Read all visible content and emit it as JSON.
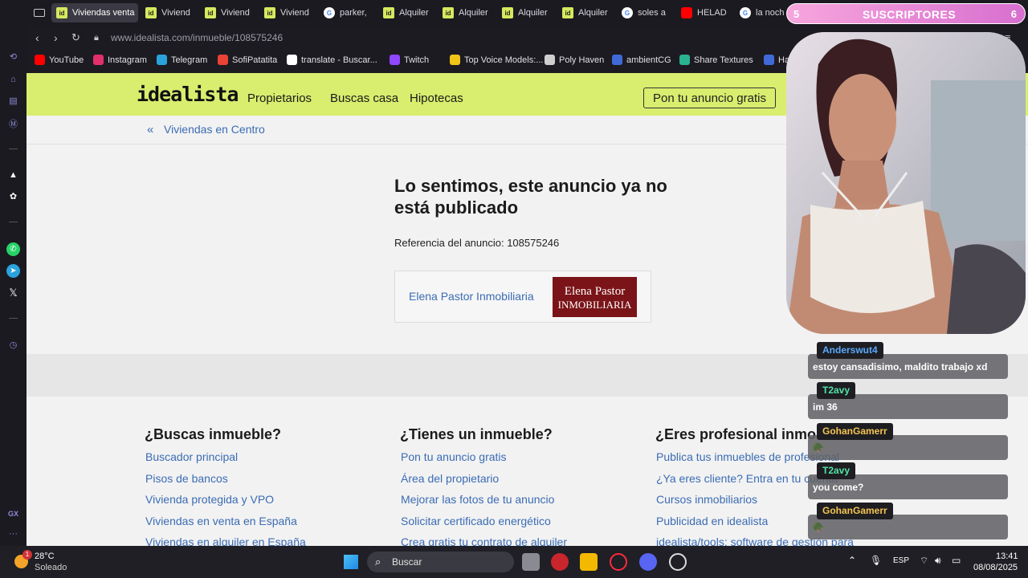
{
  "tabs": [
    {
      "label": "Viviendas venta",
      "icon": "idealista-icon",
      "active": true
    },
    {
      "label": "Viviend",
      "icon": "idealista-icon"
    },
    {
      "label": "Viviend",
      "icon": "idealista-icon"
    },
    {
      "label": "Viviend",
      "icon": "idealista-icon"
    },
    {
      "label": "parker,",
      "icon": "google-icon"
    },
    {
      "label": "Alquiler",
      "icon": "idealista-icon"
    },
    {
      "label": "Alquiler",
      "icon": "idealista-icon"
    },
    {
      "label": "Alquiler",
      "icon": "idealista-icon"
    },
    {
      "label": "Alquiler",
      "icon": "idealista-icon"
    },
    {
      "label": "soles a",
      "icon": "google-icon"
    },
    {
      "label": "HELAD",
      "icon": "youtube-icon"
    },
    {
      "label": "la noch",
      "icon": "google-icon"
    }
  ],
  "address_bar": {
    "url": "www.idealista.com/inmueble/108575246"
  },
  "bookmarks": [
    {
      "label": "YouTube",
      "color": "#ff0000"
    },
    {
      "label": "Instagram",
      "color": "#e1306c"
    },
    {
      "label": "Telegram",
      "color": "#2aa3dd"
    },
    {
      "label": "SofiPatatita",
      "color": "#ea4335"
    },
    {
      "label": "translate - Buscar...",
      "color": "#ffffff"
    },
    {
      "label": "Twitch",
      "color": "#9146ff"
    },
    {
      "label": "Top Voice Models:...",
      "color": "#f0c419"
    },
    {
      "label": "Poly Haven",
      "color": "#cfcfcf"
    },
    {
      "label": "ambientCG",
      "color": "#3f6ad8"
    },
    {
      "label": "Share Textures",
      "color": "#2bb38f"
    },
    {
      "label": "Har",
      "color": "#3f6ad8"
    }
  ],
  "site": {
    "logo": "idealista",
    "nav": [
      "Propietarios",
      "Buscas casa",
      "Hipotecas"
    ],
    "cta": "Pon tu anuncio gratis",
    "breadcrumb": "Viviendas en Centro",
    "heading": "Lo sentimos, este anuncio ya no está publicado",
    "reference": "Referencia del anuncio: 108575246",
    "agency_name": "Elena Pastor Inmobiliaria",
    "agency_logo_line1": "Elena Pastor",
    "agency_logo_line2": "INMOBILIARIA",
    "accent": "#d9ed6e",
    "link_color": "#3b6cb4"
  },
  "footer": {
    "columns": [
      {
        "title": "¿Buscas inmueble?",
        "links": [
          "Buscador principal",
          "Pisos de bancos",
          "Vivienda protegida y VPO",
          "Viviendas en venta en España",
          "Viviendas en alquiler en España"
        ]
      },
      {
        "title": "¿Tienes un inmueble?",
        "links": [
          "Pon tu anuncio gratis",
          "Área del propietario",
          "Mejorar las fotos de tu anuncio",
          "Solicitar certificado energético",
          "Crea gratis tu contrato de alquiler"
        ]
      },
      {
        "title": "¿Eres profesional inmob",
        "links": [
          "Publica tus inmuebles de profesional",
          "¿Ya eres cliente? Entra en tu cuenta",
          "Cursos inmobiliarios",
          "Publicidad en idealista",
          "idealista/tools: software de gestión para"
        ]
      }
    ]
  },
  "stream": {
    "subs_left": "5",
    "subs_label": "SUSCRIPTORES",
    "subs_right": "6",
    "chat": [
      {
        "user": "Anderswut4",
        "color": "#5aa9ff",
        "message": "estoy cansadisimo, maldito trabajo xd"
      },
      {
        "user": "T2avy",
        "color": "#53e3a6",
        "message": "im 36"
      },
      {
        "user": "GohanGamerr",
        "color": "#f5c451",
        "message": "🪖"
      },
      {
        "user": "T2avy",
        "color": "#53e3a6",
        "message": "you come?"
      },
      {
        "user": "GohanGamerr",
        "color": "#f5c451",
        "message": "🪖"
      }
    ]
  },
  "taskbar": {
    "temperature": "28°C",
    "weather": "Soleado",
    "weather_badge": "1",
    "search_placeholder": "Buscar",
    "language": "ESP",
    "time": "13:41",
    "date": "08/08/2025"
  },
  "sidebar": {
    "gx_label": "GX"
  }
}
